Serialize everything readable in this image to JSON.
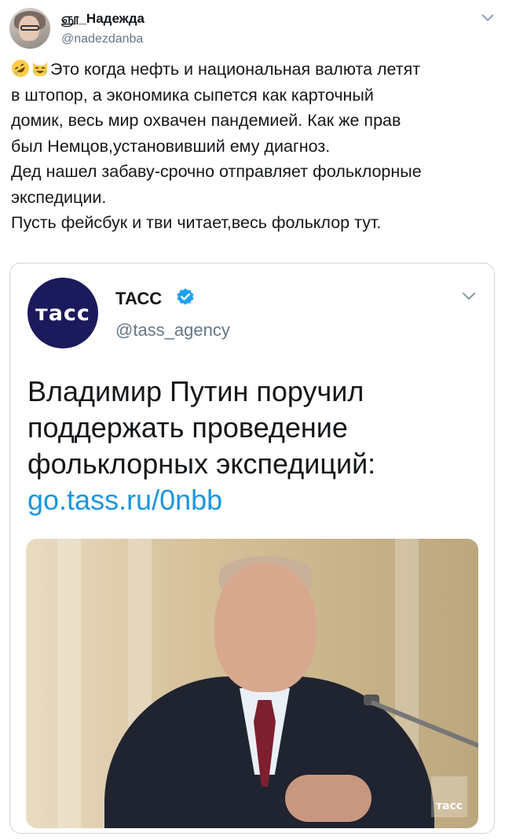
{
  "tweet": {
    "display_name": "ஞூ_Надежда",
    "handle": "@nadezdanba",
    "emojis": [
      "rolling-on-floor-laughing",
      "laughing-cat"
    ],
    "text_lines": [
      "Это когда нефть и национальная валюта летят",
      "в штопор, а экономика сыпется как карточный",
      "домик, весь мир охвачен пандемией. Как же прав",
      "был Немцов,установивший ему диагноз.",
      "Дед нашел забаву-срочно отправляет фольклорные",
      "экспедиции.",
      "Пусть фейсбук и тви читает,весь фольклор тут."
    ]
  },
  "quoted": {
    "logo_text": "тасс",
    "name": "ТАСС",
    "verified": true,
    "handle": "@tass_agency",
    "text_lines": [
      "Владимир Путин поручил",
      "поддержать проведение",
      "фольклорных экспедиций:"
    ],
    "link": "go.tass.ru/0nbb",
    "photo_watermark": "тасс"
  },
  "colors": {
    "text": "#14171a",
    "secondary": "#657786",
    "link": "#1b95e0",
    "verified": "#1da1f2",
    "tass_brand": "#1b1a5c",
    "border": "#ccd6dd"
  }
}
